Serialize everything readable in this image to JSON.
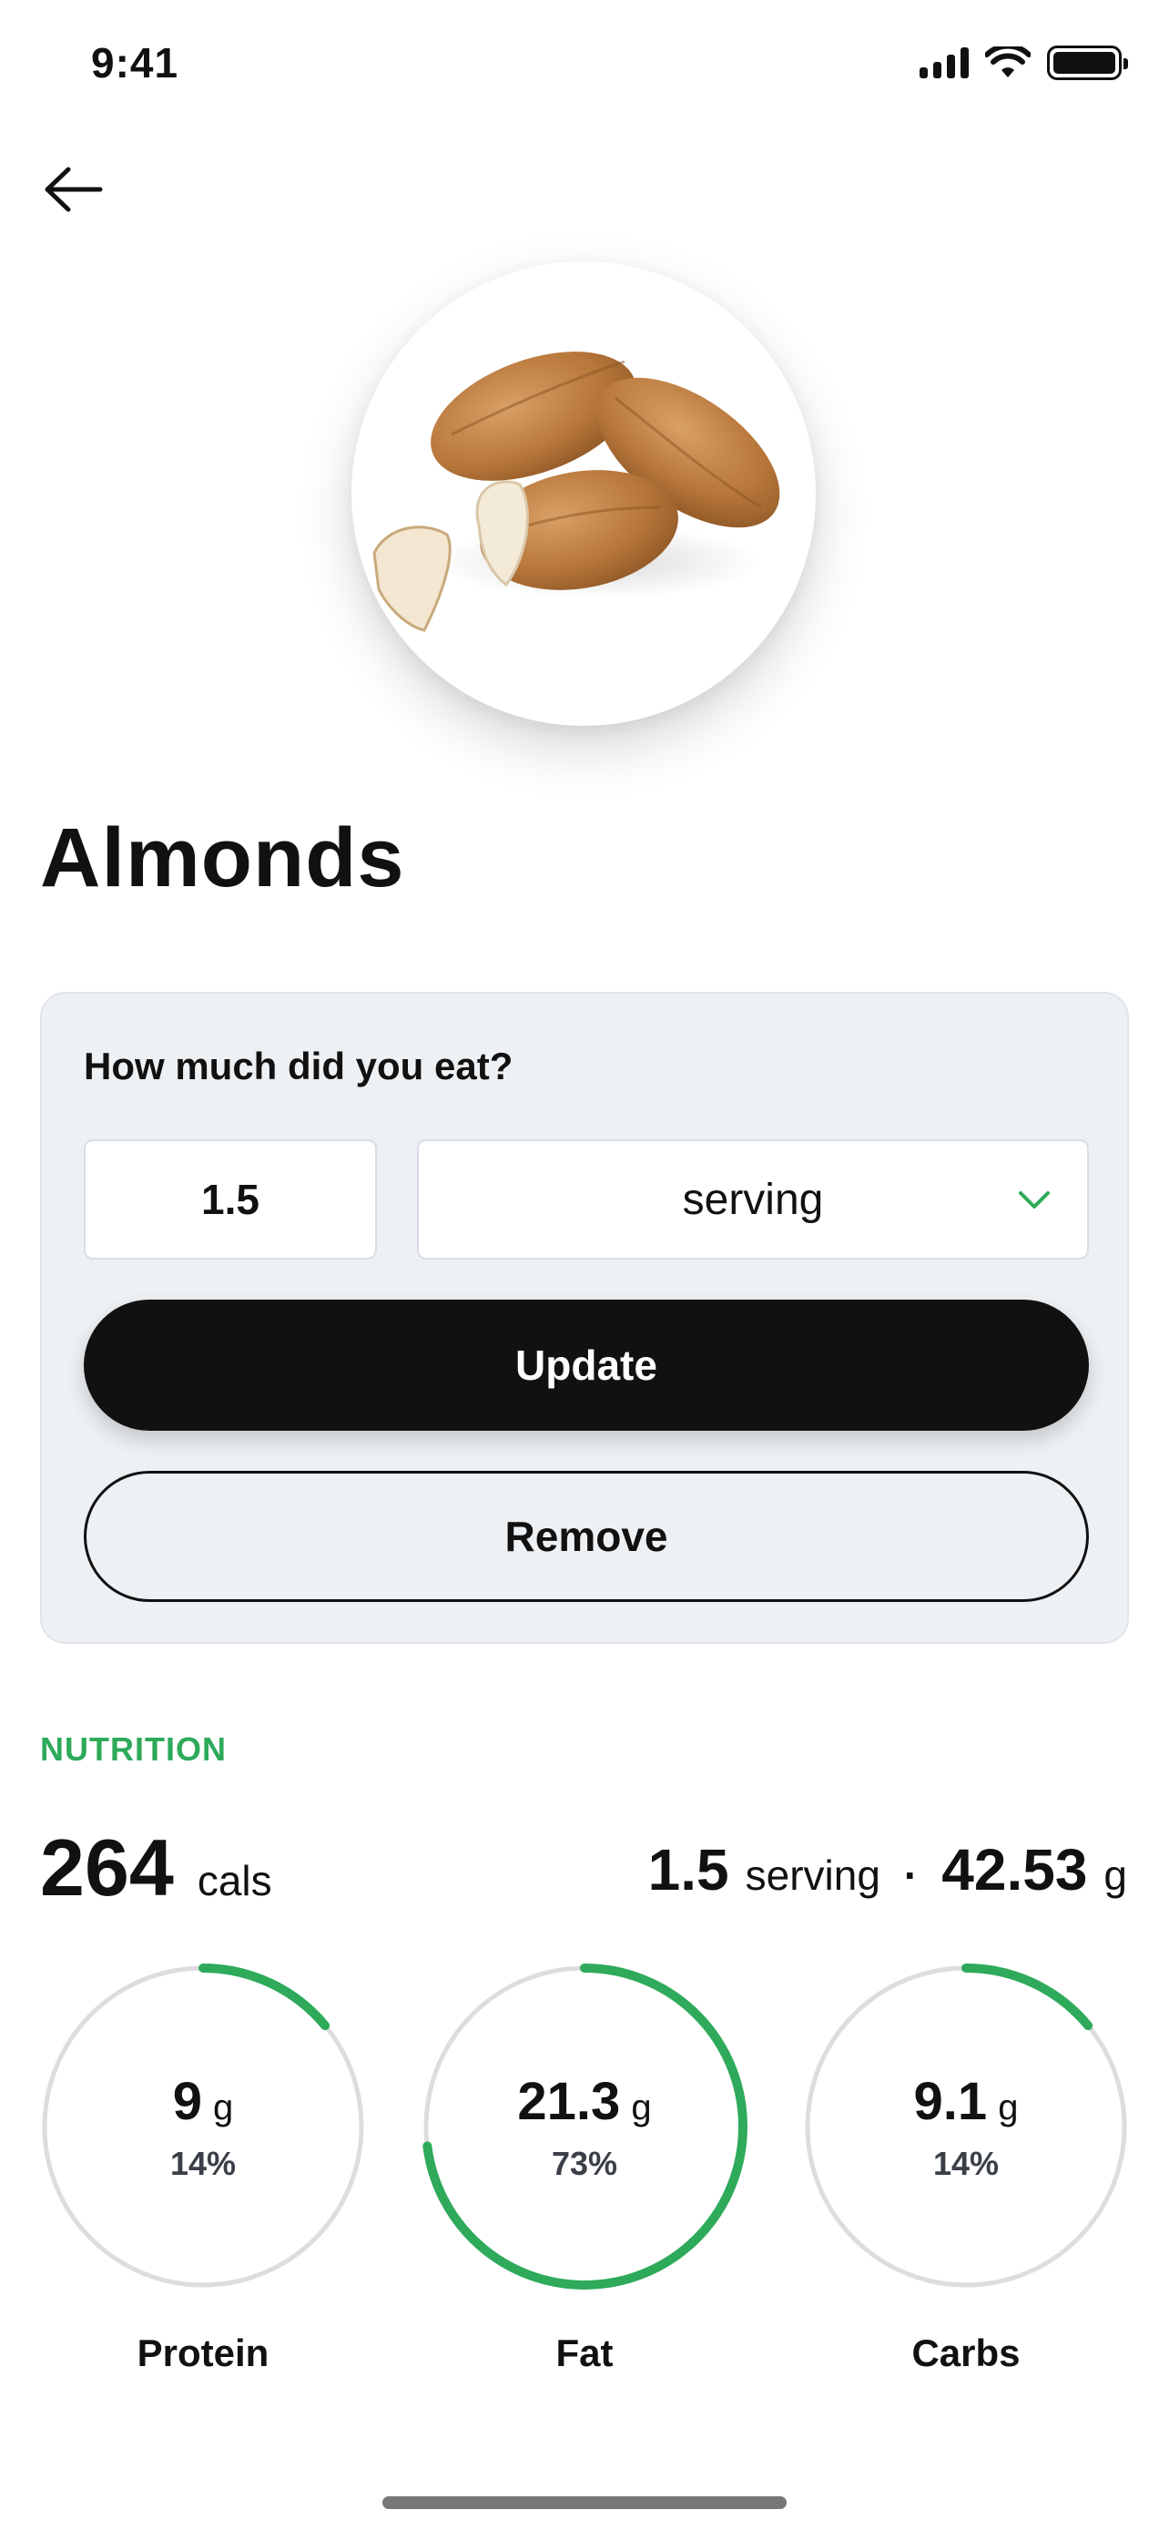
{
  "status_bar": {
    "time": "9:41"
  },
  "food": {
    "name": "Almonds"
  },
  "amount": {
    "question": "How much did you eat?",
    "quantity": "1.5",
    "unit": "serving",
    "update_label": "Update",
    "remove_label": "Remove"
  },
  "nutrition": {
    "section_label": "NUTRITION",
    "calories": "264",
    "calories_unit": "cals",
    "serving_qty": "1.5",
    "serving_unit": "serving",
    "separator": "·",
    "weight": "42.53",
    "weight_unit": "g",
    "macros": [
      {
        "name": "Protein",
        "amount": "9",
        "unit": "g",
        "percent": "14%",
        "fraction": 0.14
      },
      {
        "name": "Fat",
        "amount": "21.3",
        "unit": "g",
        "percent": "73%",
        "fraction": 0.73
      },
      {
        "name": "Carbs",
        "amount": "9.1",
        "unit": "g",
        "percent": "14%",
        "fraction": 0.14
      }
    ]
  },
  "colors": {
    "accent": "#2eaa5a",
    "ring_track": "#dddddd",
    "button_dark": "#111111",
    "card_bg": "#eef1f4"
  }
}
